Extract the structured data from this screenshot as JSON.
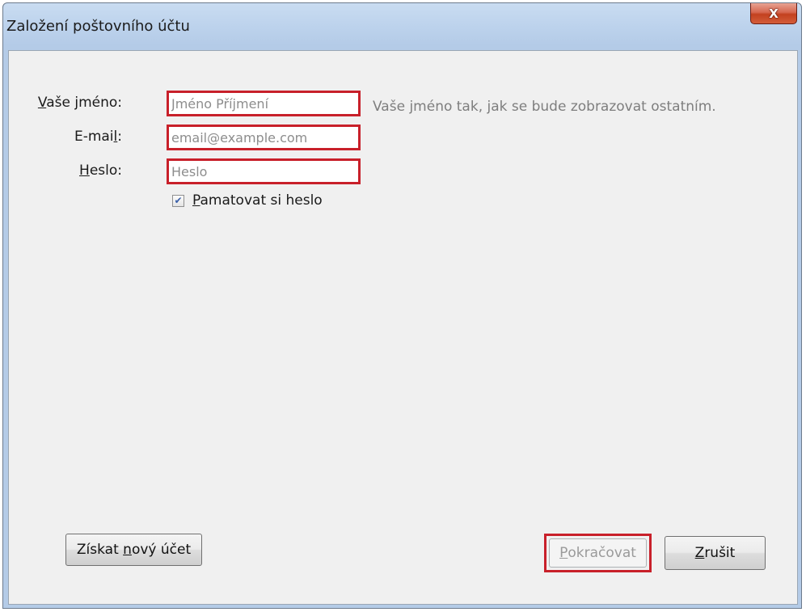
{
  "window": {
    "title": "Založení poštovního účtu",
    "close_label": "X"
  },
  "form": {
    "name_label": "Vaše jméno:",
    "name_placeholder": "Jméno Příjmení",
    "name_value": "",
    "name_hint": "Vaše jméno tak, jak se bude zobrazovat ostatním.",
    "email_label": "E-mail:",
    "email_placeholder": "email@example.com",
    "email_value": "",
    "password_label": "Heslo:",
    "password_placeholder": "Heslo",
    "password_value": "",
    "remember_label": "Pamatovat si heslo",
    "remember_checked": true
  },
  "buttons": {
    "get_account": "Získat nový účet",
    "continue": "Pokračovat",
    "continue_enabled": false,
    "cancel": "Zrušit"
  },
  "colors": {
    "highlight_red": "#c8202a",
    "titlebar_blue": "#bcd2ec",
    "close_red": "#c3411f"
  }
}
